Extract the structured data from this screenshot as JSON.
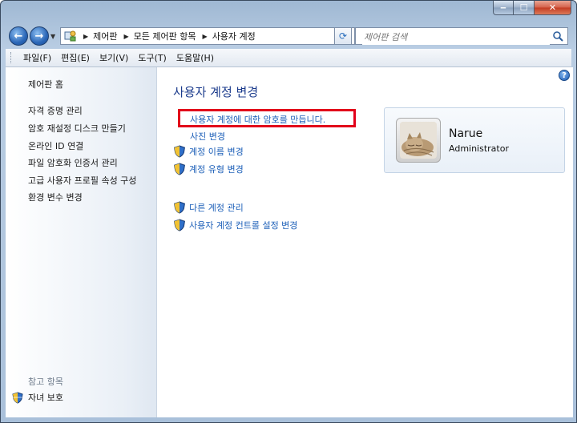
{
  "address": {
    "crumbs": [
      "제어판",
      "모든 제어판 항목",
      "사용자 계정"
    ]
  },
  "search": {
    "placeholder": "제어판 검색"
  },
  "menu": [
    "파일(F)",
    "편집(E)",
    "보기(V)",
    "도구(T)",
    "도움말(H)"
  ],
  "sidebar": {
    "items": [
      "제어판 홈",
      "자격 증명 관리",
      "암호 재설정 디스크 만들기",
      "온라인 ID 연결",
      "파일 암호화 인증서 관리",
      "고급 사용자 프로필 속성 구성",
      "환경 변수 변경"
    ],
    "see_also": "참고 항목",
    "family_safety": "자녀 보호"
  },
  "main": {
    "heading": "사용자 계정 변경",
    "tasks": [
      {
        "label": "사용자 계정에 대한 암호를 만듭니다.",
        "shield": false,
        "highlighted": true
      },
      {
        "label": "사진 변경",
        "shield": false
      },
      {
        "label": "계정 이름 변경",
        "shield": true
      },
      {
        "label": "계정 유형 변경",
        "shield": true
      }
    ],
    "tasks2": [
      {
        "label": "다른 계정 관리",
        "shield": true
      },
      {
        "label": "사용자 계정 컨트롤 설정 변경",
        "shield": true
      }
    ],
    "help_glyph": "?"
  },
  "account": {
    "name": "Narue",
    "role": "Administrator"
  },
  "colors": {
    "link": "#1c5fb8",
    "heading": "#1b3b8c",
    "highlight_border": "#e2001a"
  }
}
